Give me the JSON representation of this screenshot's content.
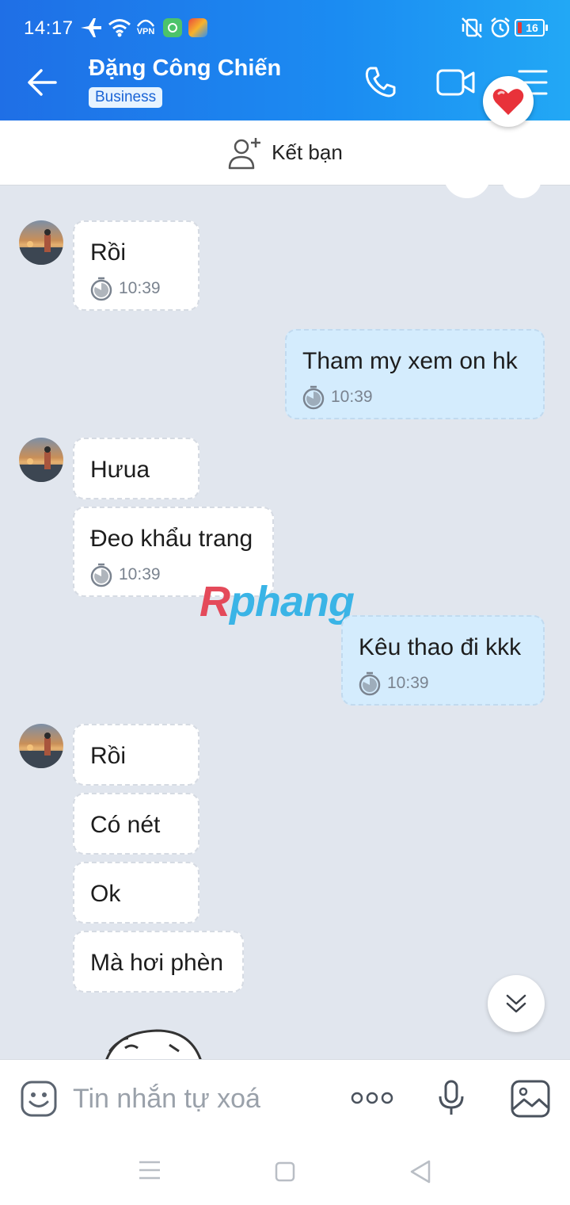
{
  "status_bar": {
    "time": "14:17",
    "vpn_label": "VPN",
    "battery": "16"
  },
  "header": {
    "contact_name": "Đặng Công Chiến",
    "badge": "Business"
  },
  "friend_bar": {
    "label": "Kết bạn"
  },
  "messages": [
    {
      "side": "in",
      "text": "Rồi",
      "time": "10:39"
    },
    {
      "side": "out",
      "text": "Tham my xem on hk",
      "time": "10:39"
    },
    {
      "side": "in",
      "text": "Hưua"
    },
    {
      "side": "in",
      "text": "Đeo khẩu trang",
      "time": "10:39"
    },
    {
      "side": "out",
      "text": "Kêu thao đi kkk",
      "time": "10:39"
    },
    {
      "side": "in",
      "text": "Rồi"
    },
    {
      "side": "in",
      "text": "Có nét"
    },
    {
      "side": "in",
      "text": "Ok"
    },
    {
      "side": "in",
      "text": "Mà hơi phèn"
    }
  ],
  "watermark": {
    "first": "R",
    "rest": "phang"
  },
  "composer": {
    "placeholder": "Tin nhắn tự xoá"
  },
  "icons": {
    "status": [
      "airplane-icon",
      "wifi-icon",
      "vpn-icon",
      "app-icon",
      "app-icon",
      "vibrate-off-icon",
      "alarm-icon",
      "battery-icon"
    ],
    "header": [
      "back-arrow-icon",
      "phone-icon",
      "video-call-icon",
      "menu-icon",
      "heart-icon"
    ],
    "composer": [
      "emoji-icon",
      "more-icon",
      "microphone-icon",
      "image-icon"
    ],
    "nav": [
      "recents-icon",
      "home-icon",
      "back-icon"
    ]
  },
  "colors": {
    "header_gradient_start": "#1f6fe6",
    "header_gradient_end": "#22a8f5",
    "chat_bg": "#e1e6ee",
    "outgoing_bubble": "#d4ecfd",
    "incoming_bubble": "#ffffff"
  }
}
